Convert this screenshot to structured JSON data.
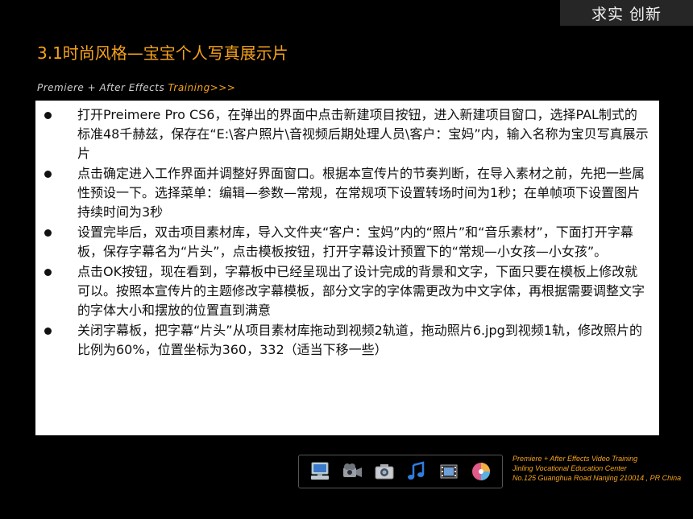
{
  "brand": {
    "text": "求实 创新"
  },
  "slide": {
    "title": "3.1时尚风格—宝宝个人写真展示片",
    "subtitle_prefix": "Premiere + After Effects ",
    "subtitle_highlight": "Training>>>"
  },
  "bullets": [
    {
      "text": "打开Preimere Pro CS6，在弹出的界面中点击新建项目按钮，进入新建项目窗口，选择PAL制式的标准48千赫兹，保存在“E:\\客户照片\\音视频后期处理人员\\客户：宝妈”内，输入名称为宝贝写真展示片"
    },
    {
      "text": "点击确定进入工作界面并调整好界面窗口。根据本宣传片的节奏判断，在导入素材之前，先把一些属性预设一下。选择菜单：编辑—参数—常规，在常规项下设置转场时间为1秒；在单帧项下设置图片持续时间为3秒"
    },
    {
      "text": "设置完毕后，双击项目素材库，导入文件夹“客户：宝妈”内的“照片”和“音乐素材”，下面打开字幕板，保存字幕名为“片头”，点击模板按钮，打开字幕设计预置下的“常规—小女孩—小女孩”。"
    },
    {
      "text": "点击OK按钮，现在看到，字幕板中已经呈现出了设计完成的背景和文字，下面只要在模板上修改就可以。按照本宣传片的主题修改字幕模板，部分文字的字体需更改为中文字体，再根据需要调整文字的字体大小和摆放的位置直到满意"
    },
    {
      "text": "关闭字幕板，把字幕“片头”从项目素材库拖动到视频2轨道，拖动照片6.jpg到视频1轨，修改照片的比例为60%，位置坐标为360，332（适当下移一些）"
    }
  ],
  "icons": [
    "computer-icon",
    "video-camera-icon",
    "photo-camera-icon",
    "music-note-icon",
    "film-icon",
    "color-disc-icon"
  ],
  "footer": {
    "line1": "Premiere + After Effects Video Training",
    "line2": "Jinling Vocational Education Center",
    "line3": "No.125 Guanghua Road Nanjing 210014 , PR China"
  }
}
